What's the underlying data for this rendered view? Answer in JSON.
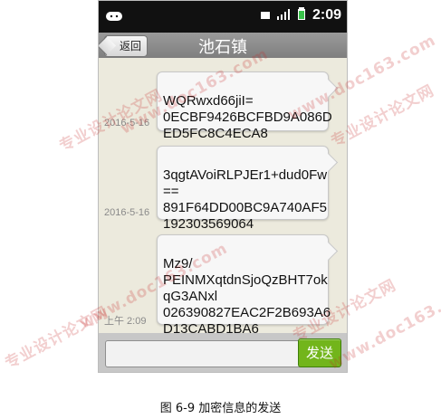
{
  "status_bar": {
    "time": "2:09",
    "left_icon": "android-icon"
  },
  "header": {
    "back_label": "返回",
    "title": "池石镇"
  },
  "messages": [
    {
      "date": "2016-5-16",
      "text": "WQRwxd66jiI=\n0ECBF9426BCFBD9A086D\nED5FC8C4ECA8"
    },
    {
      "date": "2016-5-16",
      "text": "3qgtAVoiRLPJEr1+dud0Fw\n==\n891F64DD00BC9A740AF5\n192303569064"
    },
    {
      "date": "上午 2:09",
      "text": "Mz9/\nPEINMXqtdnSjoQzBHT7ok\nqG3ANxl\n026390827EAC2F2B693A6\nD13CABD1BA6"
    }
  ],
  "composer": {
    "input_value": "",
    "send_label": "发送"
  },
  "caption": "图 6-9 加密信息的发送",
  "watermark": {
    "text1": "专业设计论文网",
    "text2": "www.doc163.com"
  },
  "colors": {
    "accent_send": "#72b51b",
    "titlebar": "#8b8b8b",
    "chat_bg": "#eceadd"
  }
}
